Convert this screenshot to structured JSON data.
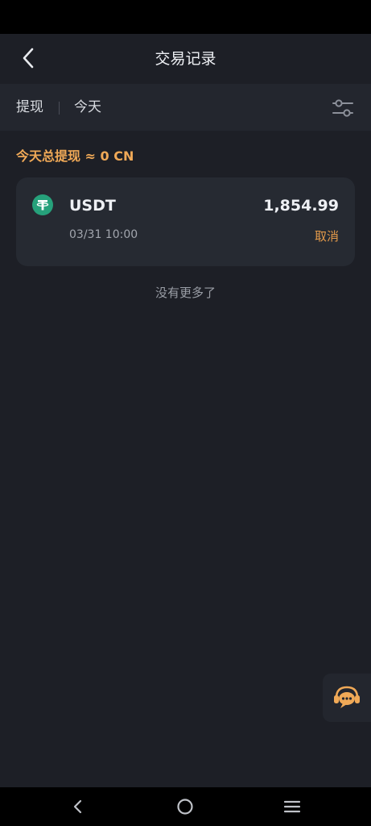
{
  "header": {
    "title": "交易记录",
    "back_icon": "chevron-left-icon"
  },
  "filter": {
    "type_label": "提现",
    "date_label": "今天",
    "settings_icon": "sliders-icon"
  },
  "summary": {
    "text": "今天总提现 ≈ 0 CN"
  },
  "transactions": [
    {
      "coin": "USDT",
      "icon": "tether-icon",
      "icon_color": "#26a17b",
      "amount": "1,854.99",
      "time": "03/31 10:00",
      "status": "取消",
      "status_color": "#e49a4a"
    }
  ],
  "list_footer": "没有更多了",
  "support": {
    "icon": "customer-service-icon",
    "color": "#f0a957"
  },
  "system_nav": {
    "back_icon": "nav-back-icon",
    "home_icon": "nav-home-icon",
    "menu_icon": "nav-menu-icon"
  },
  "colors": {
    "accent": "#f0a957",
    "background": "#1d1f26",
    "card": "#262a32"
  }
}
